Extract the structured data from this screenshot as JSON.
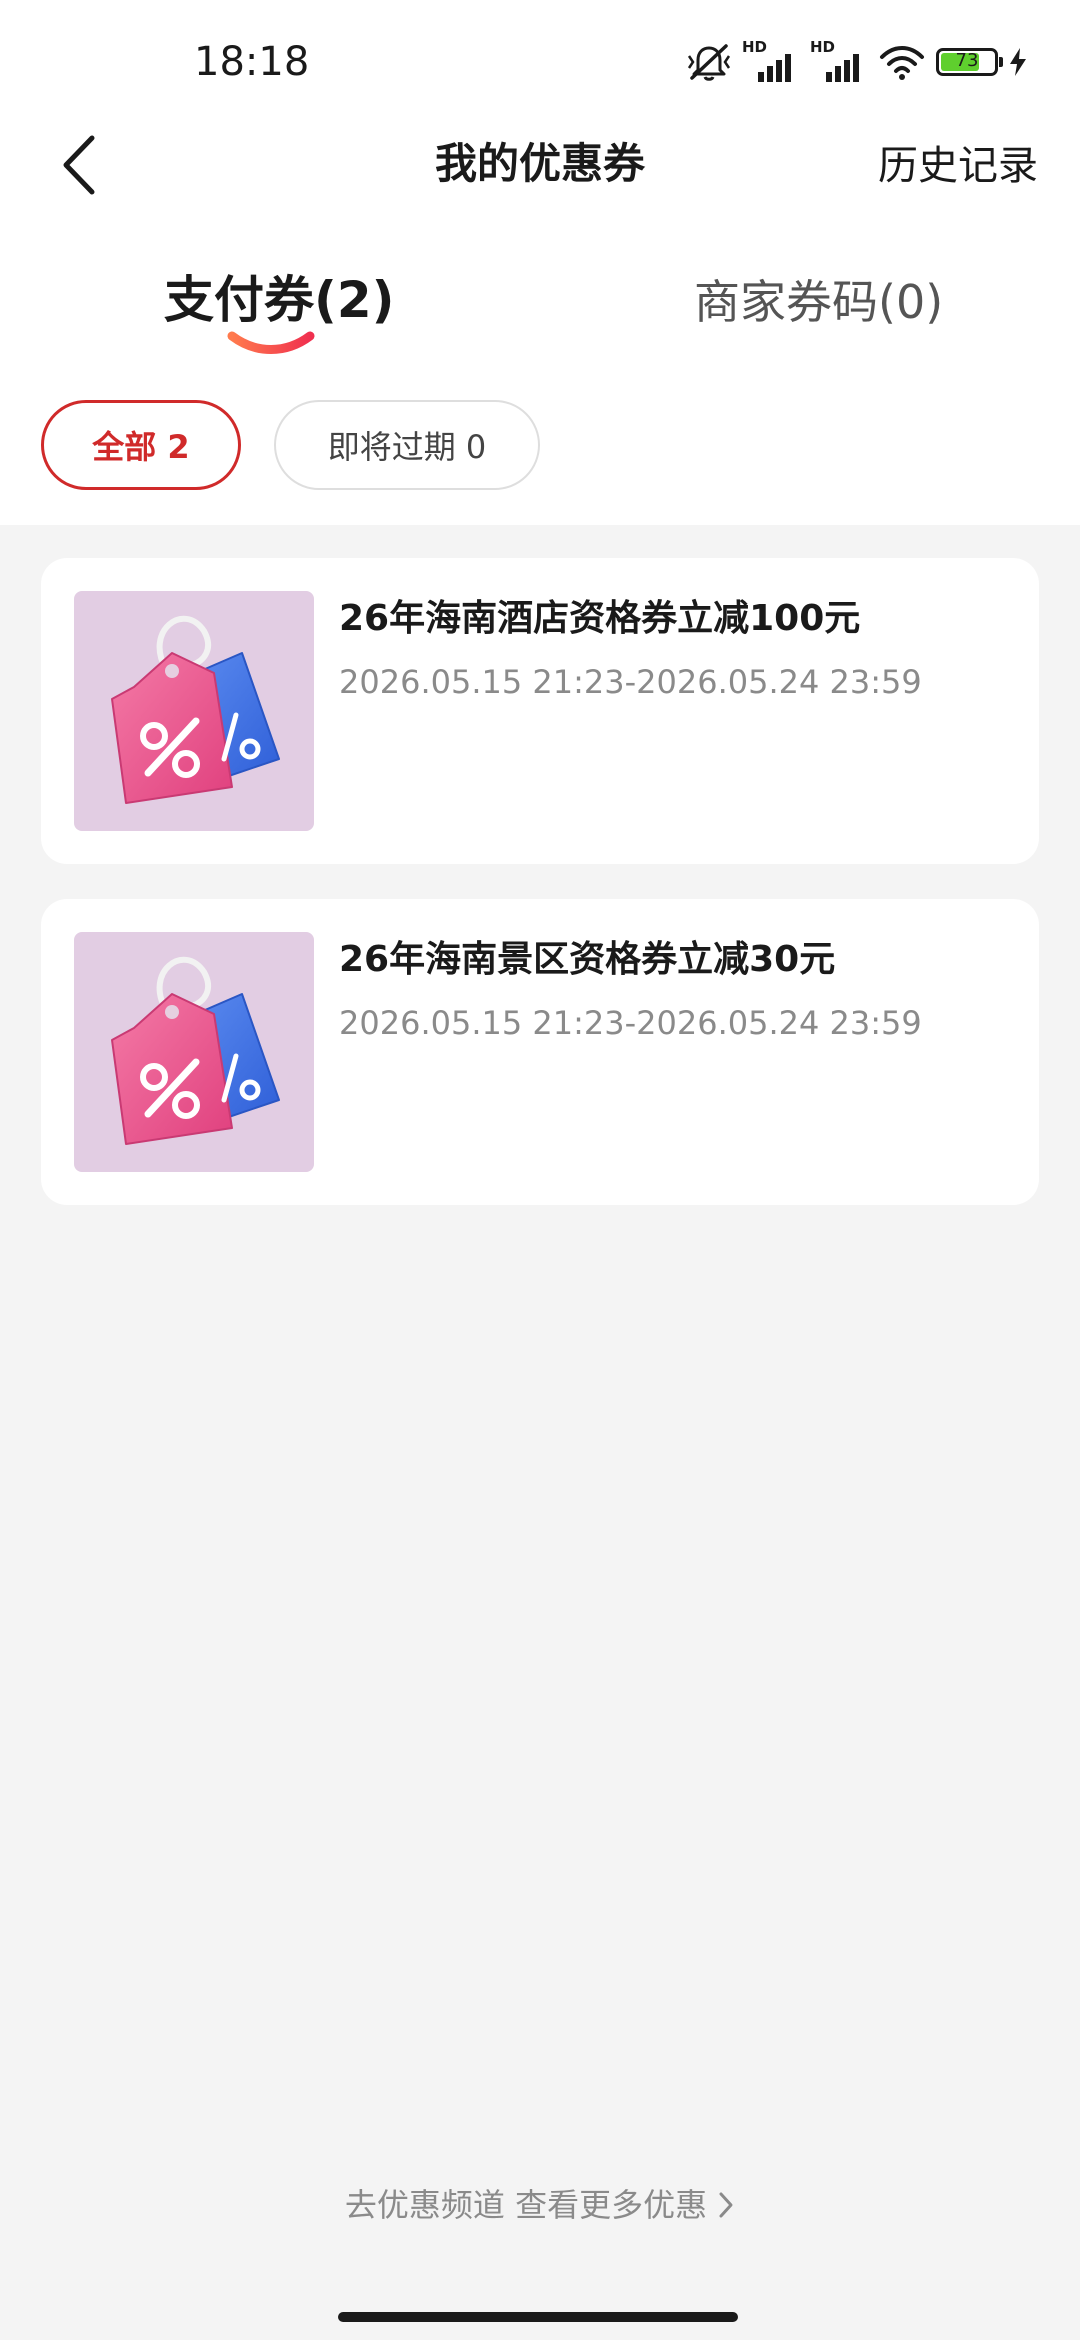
{
  "status_bar": {
    "time": "18:18",
    "hd_label_1": "HD",
    "hd_label_2": "HD",
    "battery_level": "73",
    "icons": [
      "mute-icon",
      "signal-icon",
      "signal-icon",
      "wifi-icon",
      "battery-icon",
      "charging-icon"
    ]
  },
  "header": {
    "title": "我的优惠券",
    "history_label": "历史记录",
    "back_icon": "chevron-left-icon"
  },
  "tabs": [
    {
      "label": "支付券(2)",
      "active": true
    },
    {
      "label": "商家券码(0)",
      "active": false
    }
  ],
  "filters": [
    {
      "label": "全部 2",
      "active": true
    },
    {
      "label": "即将过期 0",
      "active": false
    }
  ],
  "coupons": [
    {
      "title": "26年海南酒店资格券立减100元",
      "validity": "2026.05.15 21:23-2026.05.24 23:59",
      "thumbnail": "discount-tag-image"
    },
    {
      "title": "26年海南景区资格券立减30元",
      "validity": "2026.05.15 21:23-2026.05.24 23:59",
      "thumbnail": "discount-tag-image"
    }
  ],
  "footer": {
    "more_label": "去优惠频道 查看更多优惠"
  },
  "colors": {
    "accent": "#d02a2a",
    "page_bg": "#f4f4f4",
    "card_bg": "#ffffff",
    "muted_text": "#8a8a8a",
    "thumb_bg": "#e2cde3",
    "tag_pink": "#ec4f8a",
    "tag_blue": "#3f74e6"
  }
}
